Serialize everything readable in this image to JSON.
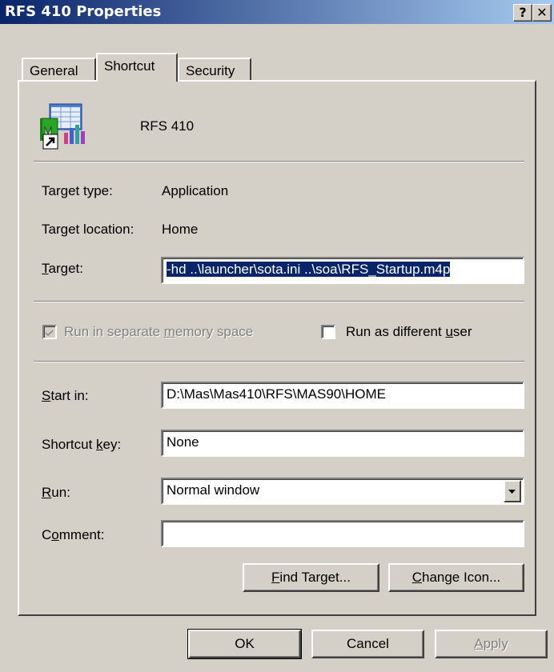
{
  "window": {
    "title": "RFS 410 Properties",
    "help_label": "?",
    "close_label": "✕"
  },
  "tabs": [
    {
      "label": "General",
      "active": false
    },
    {
      "label": "Shortcut",
      "active": true
    },
    {
      "label": "Security",
      "active": false
    }
  ],
  "shortcut": {
    "name": "RFS 410",
    "target_type_label": "Target type:",
    "target_type_value": "Application",
    "target_location_label": "Target location:",
    "target_location_value": "Home",
    "target_label_first": "T",
    "target_label_rest": "arget:",
    "target_value": "-hd ..\\launcher\\sota.ini ..\\soa\\RFS_Startup.m4p",
    "run_separate_pre": "Run in separate ",
    "run_separate_accel": "m",
    "run_separate_post": "emory space",
    "run_separate_checked": true,
    "run_as_pre": "Run as different ",
    "run_as_accel": "u",
    "run_as_post": "ser",
    "run_as_checked": false,
    "start_in_first": "S",
    "start_in_rest": "tart in:",
    "start_in_value": "D:\\Mas\\Mas410\\RFS\\MAS90\\HOME",
    "shortcut_key_pre": "Shortcut ",
    "shortcut_key_accel": "k",
    "shortcut_key_post": "ey:",
    "shortcut_key_value": "None",
    "run_first": "R",
    "run_rest": "un:",
    "run_value": "Normal window",
    "comment_pre": "C",
    "comment_accel": "o",
    "comment_post": "mment:",
    "comment_value": "",
    "find_target_accel": "F",
    "find_target_rest": "ind Target...",
    "change_icon_accel": "C",
    "change_icon_rest": "hange Icon..."
  },
  "footer": {
    "ok_label": "OK",
    "cancel_label": "Cancel",
    "apply_accel": "A",
    "apply_rest": "pply"
  }
}
